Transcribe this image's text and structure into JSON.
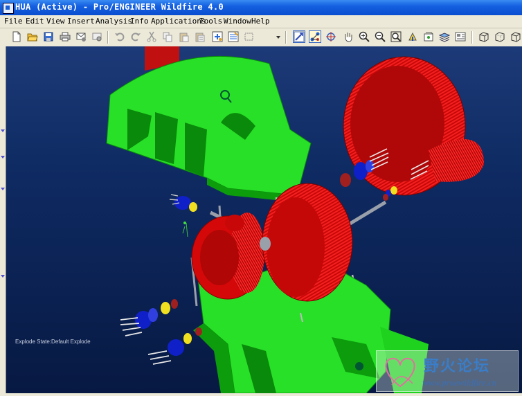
{
  "window": {
    "title": "HUA (Active) - Pro/ENGINEER Wildfire 4.0"
  },
  "menubar": {
    "items": [
      {
        "label": "File"
      },
      {
        "label": "Edit"
      },
      {
        "label": "View"
      },
      {
        "label": "Insert"
      },
      {
        "label": "Analysis"
      },
      {
        "label": "Info"
      },
      {
        "label": "Applications"
      },
      {
        "label": "Tools"
      },
      {
        "label": "Window"
      },
      {
        "label": "Help"
      }
    ]
  },
  "toolbar": {
    "buttons": [
      {
        "icon": "new-icon"
      },
      {
        "icon": "open-icon"
      },
      {
        "icon": "save-icon"
      },
      {
        "icon": "print-icon"
      },
      {
        "icon": "send-mail-icon"
      },
      {
        "icon": "send-link-icon"
      },
      {
        "icon": "undo-icon"
      },
      {
        "icon": "redo-icon"
      },
      {
        "icon": "cut-icon"
      },
      {
        "icon": "copy-icon"
      },
      {
        "icon": "paste-icon"
      },
      {
        "icon": "paste-special-icon"
      },
      {
        "icon": "regenerate-icon"
      },
      {
        "icon": "regen-manager-icon"
      },
      {
        "icon": "selection-box-icon"
      },
      {
        "icon": "dropdown-arrow-icon"
      },
      {
        "icon": "repaint-icon"
      },
      {
        "icon": "explode-icon"
      },
      {
        "icon": "spin-center-icon"
      },
      {
        "icon": "pan-hand-icon"
      },
      {
        "icon": "zoom-in-icon"
      },
      {
        "icon": "zoom-out-icon"
      },
      {
        "icon": "refit-icon"
      },
      {
        "icon": "reorient-icon"
      },
      {
        "icon": "saved-views-icon"
      },
      {
        "icon": "layers-icon"
      },
      {
        "icon": "view-manager-icon"
      },
      {
        "icon": "wireframe-icon"
      },
      {
        "icon": "hidden-line-icon"
      },
      {
        "icon": "no-hidden-icon"
      }
    ]
  },
  "viewport": {
    "explode_state": "Explode State:Default Explode",
    "colors": {
      "housing": "#1ed21e",
      "gear": "#d80a0a",
      "shaft": "#9aa0aa",
      "bearing_blue": "#1020c8",
      "bearing_yellow": "#f0e020"
    }
  },
  "watermark": {
    "text_cn": "野火论坛",
    "url": "www.proewildfire.cn"
  }
}
